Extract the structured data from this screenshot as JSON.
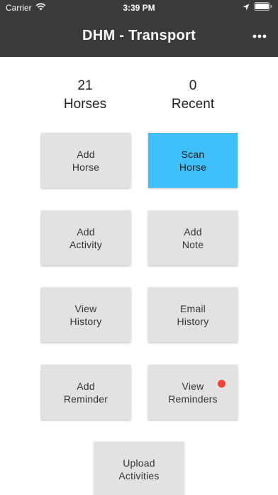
{
  "status_bar": {
    "carrier": "Carrier",
    "time": "3:39 PM",
    "icons": [
      "wifi-icon",
      "location-arrow-icon",
      "battery-icon"
    ]
  },
  "nav": {
    "title": "DHM - Transport",
    "more_icon": "more-dots-icon"
  },
  "stats": {
    "horses": {
      "count": "21",
      "label": "Horses"
    },
    "recent": {
      "count": "0",
      "label": "Recent"
    }
  },
  "tiles": {
    "add_horse": {
      "line1": "Add",
      "line2": "Horse"
    },
    "scan_horse": {
      "line1": "Scan",
      "line2": "Horse"
    },
    "add_activity": {
      "line1": "Add",
      "line2": "Activity"
    },
    "add_note": {
      "line1": "Add",
      "line2": "Note"
    },
    "view_history": {
      "line1": "View",
      "line2": "History"
    },
    "email_history": {
      "line1": "Email",
      "line2": "History"
    },
    "add_reminder": {
      "line1": "Add",
      "line2": "Reminder"
    },
    "view_reminders": {
      "line1": "View",
      "line2": "Reminders"
    },
    "upload_activities": {
      "line1": "Upload",
      "line2": "Activities"
    }
  },
  "colors": {
    "header": "#3a3a3a",
    "tile": "#e2e2e2",
    "accent": "#40c0fb",
    "badge": "#f44336"
  }
}
